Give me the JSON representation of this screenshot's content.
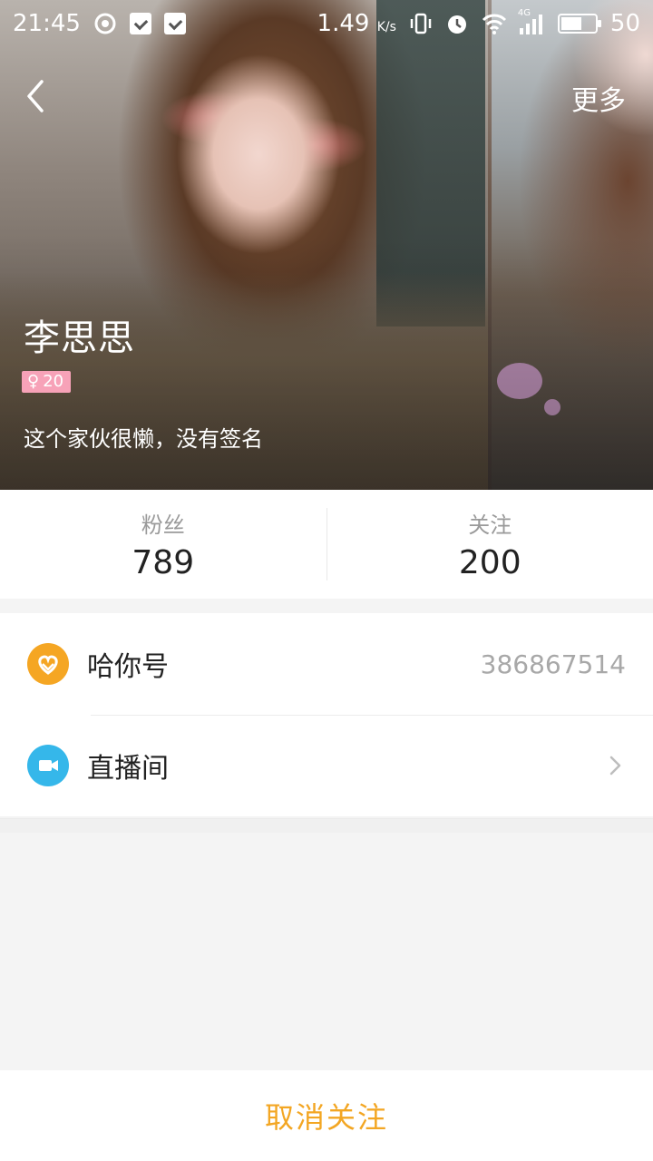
{
  "status_bar": {
    "time": "21:45",
    "speed": "1.49",
    "speed_unit": "K/s",
    "network": "4G",
    "battery": "50"
  },
  "nav": {
    "back_icon": "chevron-left-icon",
    "more_label": "更多"
  },
  "profile": {
    "name": "李思思",
    "gender_symbol": "♀",
    "age": "20",
    "signature": "这个家伙很懒，没有签名"
  },
  "stats": [
    {
      "label": "粉丝",
      "value": "789"
    },
    {
      "label": "关注",
      "value": "200"
    }
  ],
  "list": {
    "hani_id": {
      "label": "哈你号",
      "value": "386867514",
      "icon": "heart-logo-icon",
      "color": "#f5a623"
    },
    "live_room": {
      "label": "直播间",
      "icon": "video-camera-icon",
      "color": "#35b7ea"
    }
  },
  "actions": {
    "unfollow_label": "取消关注",
    "accent_color": "#f3a623"
  }
}
